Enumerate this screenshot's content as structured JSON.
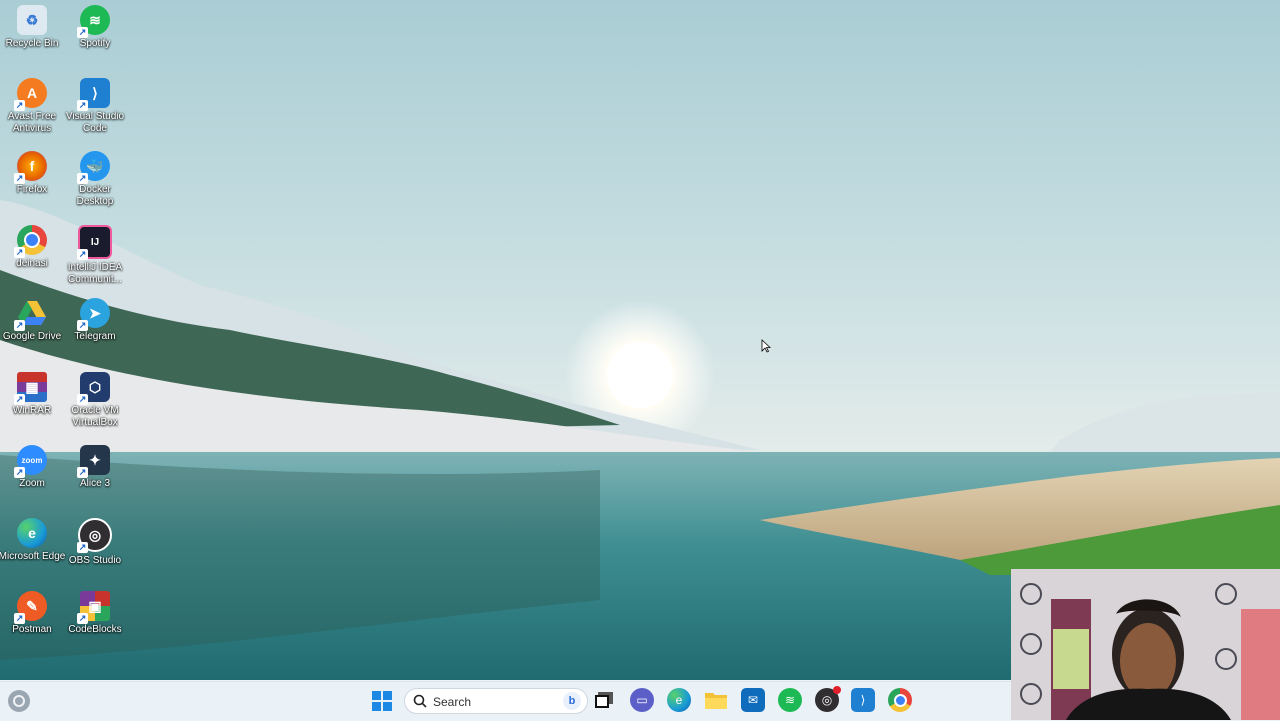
{
  "desktop": {
    "icons": [
      {
        "label": "Recycle Bin",
        "icon": "recycle-bin-icon",
        "color": "#dfe9f2"
      },
      {
        "label": "Spotify",
        "icon": "spotify-icon",
        "color": "#1db954"
      },
      {
        "label": "Avast Free Antivirus",
        "icon": "avast-icon",
        "color": "#f47b20"
      },
      {
        "label": "Visual Studio Code",
        "icon": "vscode-icon",
        "color": "#1f7fd1"
      },
      {
        "label": "Firefox",
        "icon": "firefox-icon",
        "color": "#e66000"
      },
      {
        "label": "Docker Desktop",
        "icon": "docker-icon",
        "color": "#2496ed"
      },
      {
        "label": "deinasi",
        "icon": "chrome-icon",
        "color": "#e8453c"
      },
      {
        "label": "IntelliJ IDEA Communit...",
        "icon": "intellij-icon",
        "color": "#1b1b2e"
      },
      {
        "label": "Google Drive",
        "icon": "google-drive-icon",
        "color": "#2aa55c"
      },
      {
        "label": "Telegram",
        "icon": "telegram-icon",
        "color": "#2aa3df"
      },
      {
        "label": "WinRAR",
        "icon": "winrar-icon",
        "color": "#7a3a9a"
      },
      {
        "label": "Oracle VM VirtualBox",
        "icon": "virtualbox-icon",
        "color": "#233c6e"
      },
      {
        "label": "Zoom",
        "icon": "zoom-icon",
        "color": "#2d8cff"
      },
      {
        "label": "Alice 3",
        "icon": "alice-icon",
        "color": "#24364a"
      },
      {
        "label": "Microsoft Edge",
        "icon": "edge-icon",
        "color": "#1a9bd7"
      },
      {
        "label": "OBS Studio",
        "icon": "obs-icon",
        "color": "#302e31"
      },
      {
        "label": "Postman",
        "icon": "postman-icon",
        "color": "#ef5b25"
      },
      {
        "label": "CodeBlocks",
        "icon": "codeblocks-icon",
        "color": "#c8332b"
      }
    ]
  },
  "taskbar": {
    "search_placeholder": "Search",
    "apps": [
      {
        "name": "windows-start",
        "color": "#1e88e5"
      },
      {
        "name": "task-view",
        "color": "#222222"
      },
      {
        "name": "teams-chat",
        "color": "#5b5fc7"
      },
      {
        "name": "edge",
        "color": "#1a9bd7"
      },
      {
        "name": "file-explorer",
        "color": "#f4c236"
      },
      {
        "name": "mail",
        "color": "#0f6cbd"
      },
      {
        "name": "spotify",
        "color": "#1db954"
      },
      {
        "name": "obs-studio",
        "color": "#302e31"
      },
      {
        "name": "vscode",
        "color": "#1f7fd1"
      },
      {
        "name": "chrome",
        "color": "#e8453c"
      }
    ]
  }
}
